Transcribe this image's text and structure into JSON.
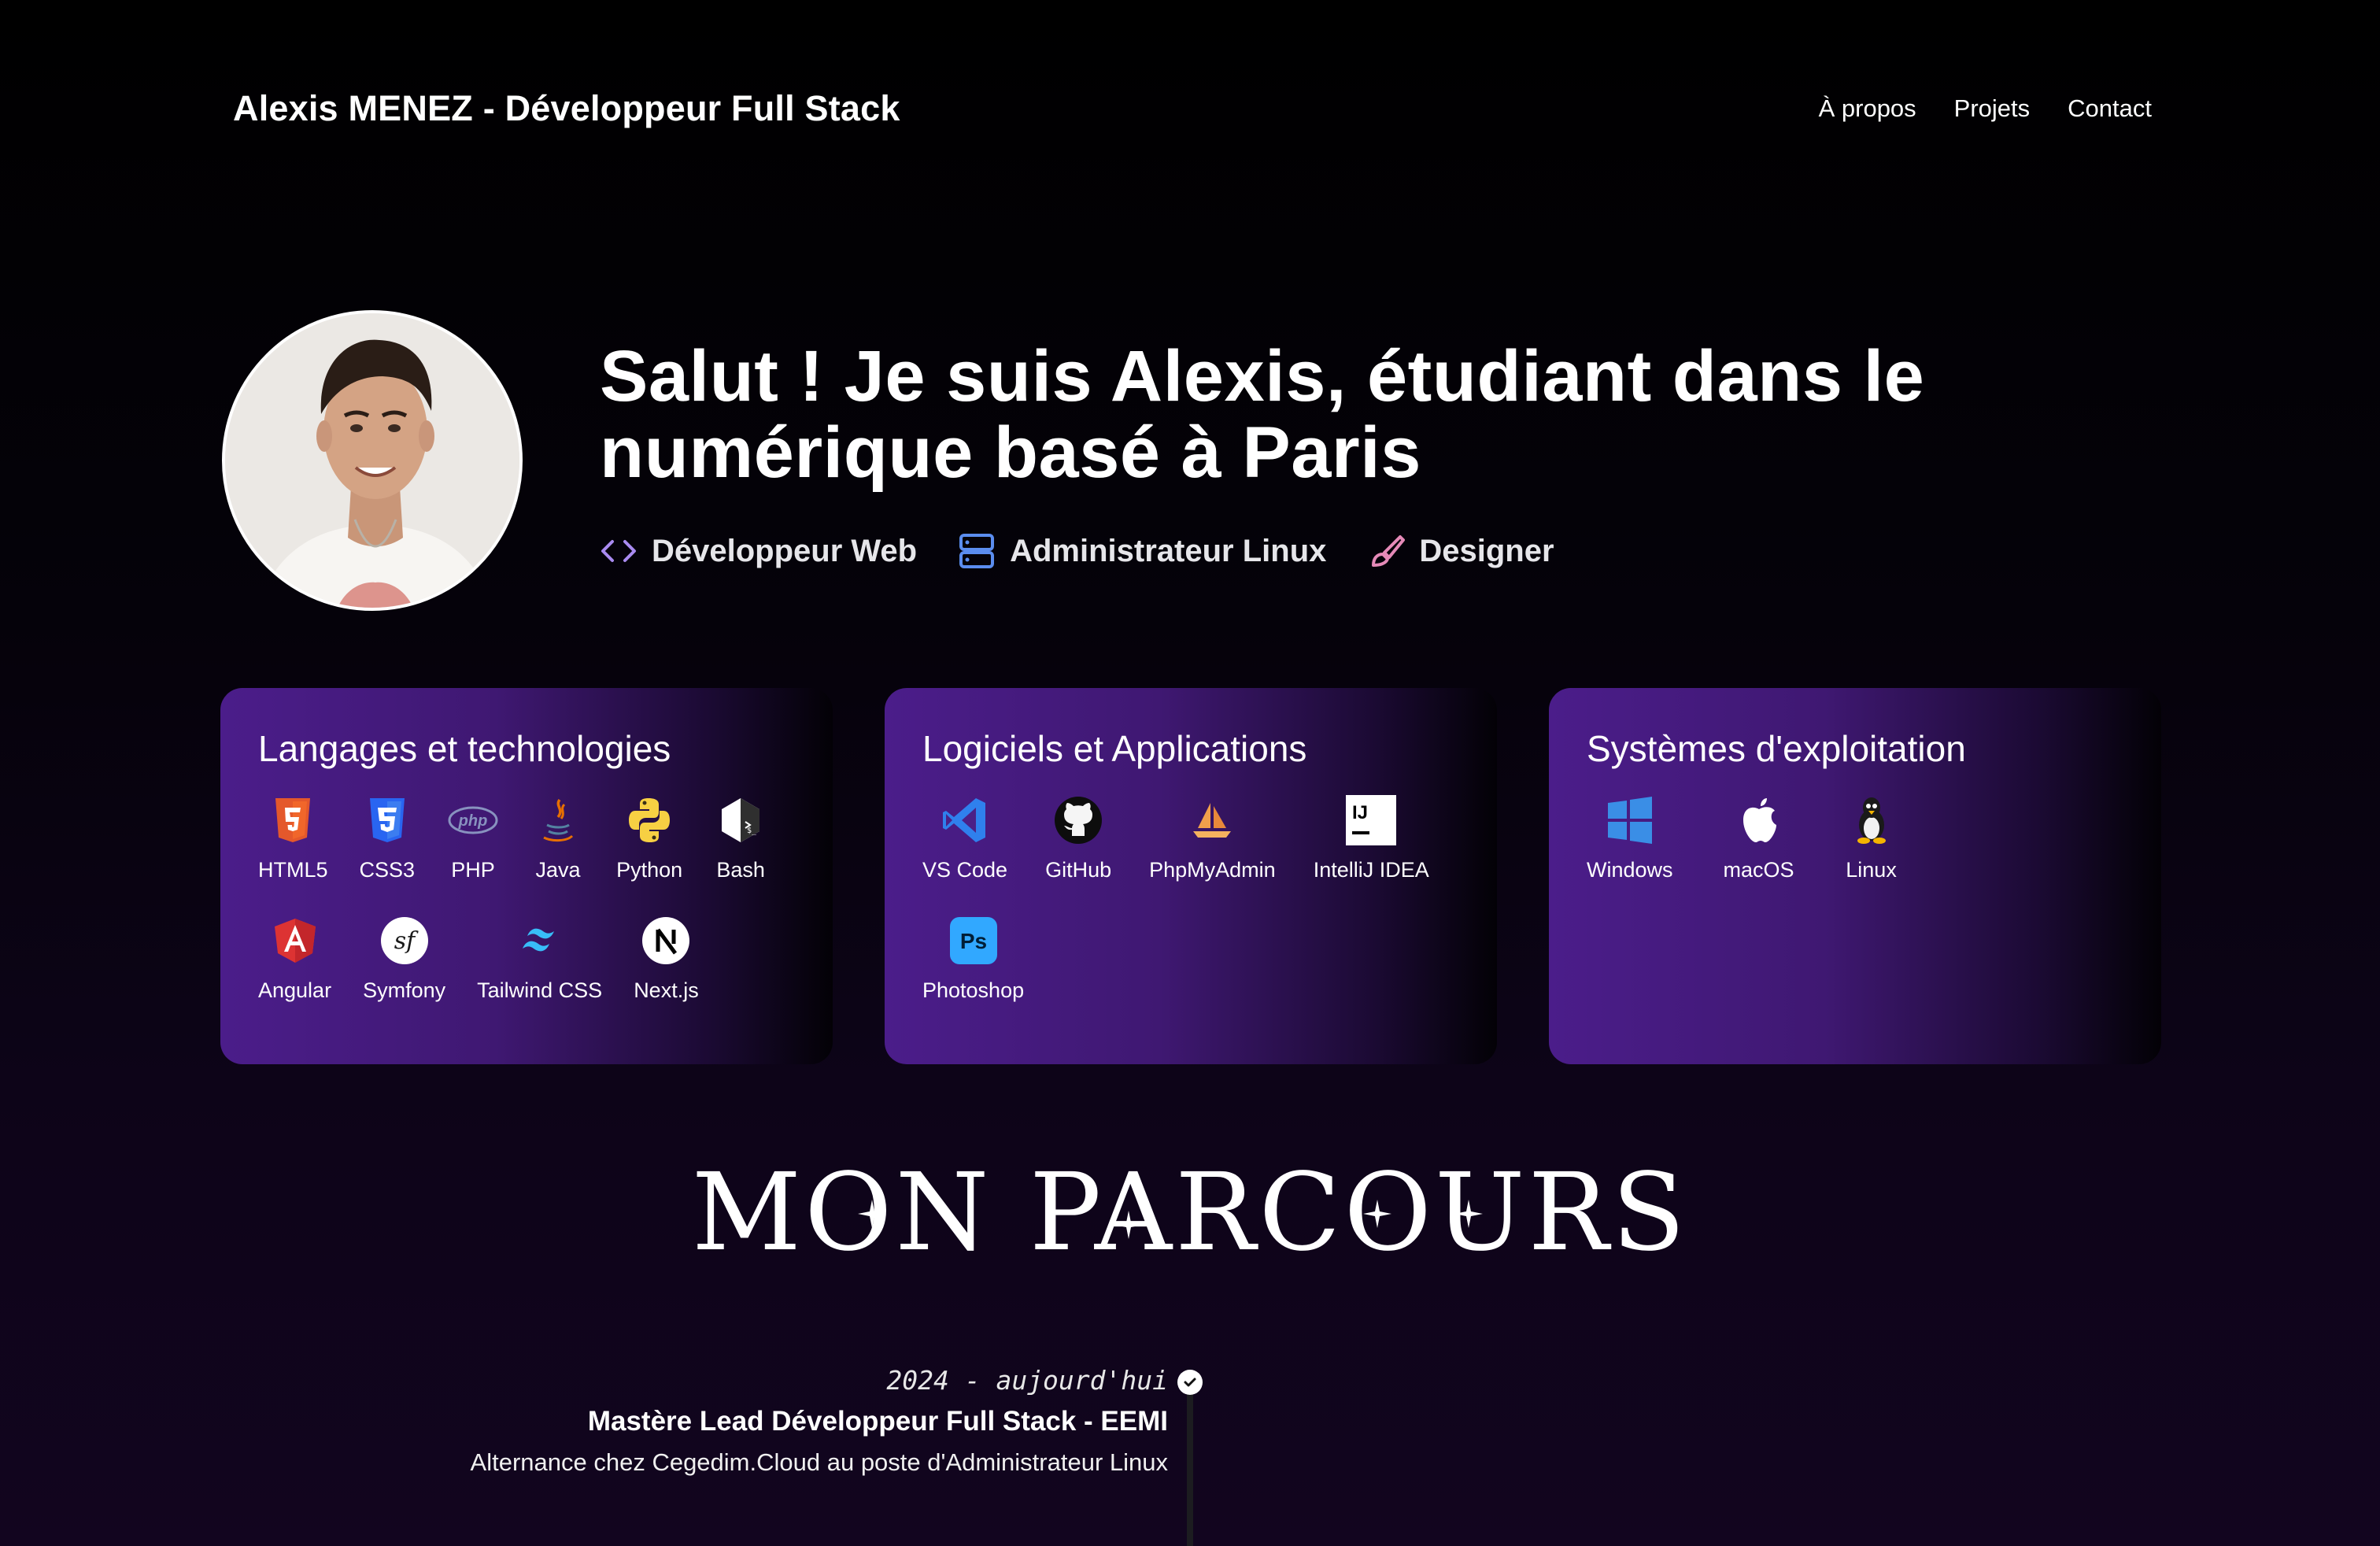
{
  "header": {
    "site_title": "Alexis MENEZ - Développeur Full Stack",
    "nav": [
      "À propos",
      "Projets",
      "Contact"
    ]
  },
  "hero": {
    "title": "Salut ! Je suis Alexis, étudiant dans le numérique basé à Paris",
    "roles": [
      {
        "label": "Développeur Web",
        "icon": "code-icon",
        "color": "#a98bf0"
      },
      {
        "label": "Administrateur Linux",
        "icon": "server-icon",
        "color": "#5b8def"
      },
      {
        "label": "Designer",
        "icon": "brush-icon",
        "color": "#e58ab8"
      }
    ]
  },
  "cards": [
    {
      "title": "Langages et technologies",
      "items": [
        "HTML5",
        "CSS3",
        "PHP",
        "Java",
        "Python",
        "Bash",
        "Angular",
        "Symfony",
        "Tailwind CSS",
        "Next.js"
      ]
    },
    {
      "title": "Logiciels et Applications",
      "items": [
        "VS Code",
        "GitHub",
        "PhpMyAdmin",
        "IntelliJ IDEA",
        "Photoshop"
      ]
    },
    {
      "title": "Systèmes d'exploitation",
      "items": [
        "Windows",
        "macOS",
        "Linux"
      ]
    }
  ],
  "parcours": {
    "title": "MON PARCOURS",
    "entries": [
      {
        "date": "2024 - aujourd'hui",
        "title": "Mastère Lead Développeur Full Stack - EEMI",
        "description": "Alternance chez Cegedim.Cloud au poste d'Administrateur Linux"
      }
    ]
  },
  "colors": {
    "card_gradient_start": "#4b1d8a",
    "accent_purple": "#a98bf0",
    "accent_blue": "#5b8def",
    "accent_pink": "#e58ab8"
  }
}
